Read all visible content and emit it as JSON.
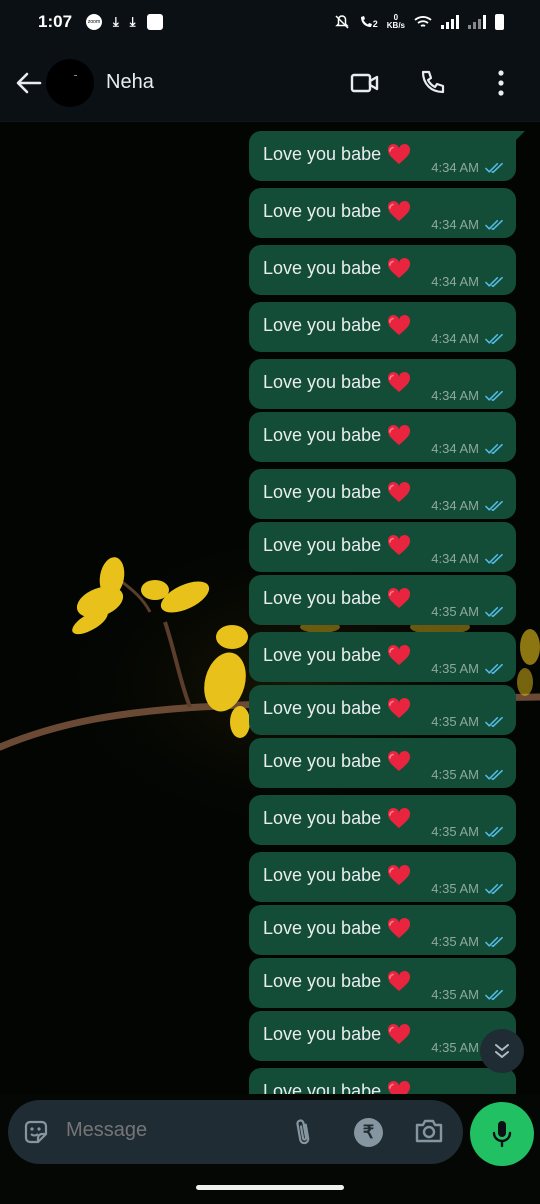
{
  "status_bar": {
    "time": "1:07",
    "data_speed_value": "0",
    "data_speed_unit": "KB/s",
    "sim_label": "2"
  },
  "header": {
    "contact_name": "Neha"
  },
  "messages": [
    {
      "text": "Love you babe",
      "time": "4:34 AM"
    },
    {
      "text": "Love you babe",
      "time": "4:34 AM"
    },
    {
      "text": "Love you babe",
      "time": "4:34 AM"
    },
    {
      "text": "Love you babe",
      "time": "4:34 AM"
    },
    {
      "text": "Love you babe",
      "time": "4:34 AM"
    },
    {
      "text": "Love you babe",
      "time": "4:34 AM"
    },
    {
      "text": "Love you babe",
      "time": "4:34 AM"
    },
    {
      "text": "Love you babe",
      "time": "4:34 AM"
    },
    {
      "text": "Love you babe",
      "time": "4:35 AM"
    },
    {
      "text": "Love you babe",
      "time": "4:35 AM"
    },
    {
      "text": "Love you babe",
      "time": "4:35 AM"
    },
    {
      "text": "Love you babe",
      "time": "4:35 AM"
    },
    {
      "text": "Love you babe",
      "time": "4:35 AM"
    },
    {
      "text": "Love you babe",
      "time": "4:35 AM"
    },
    {
      "text": "Love you babe",
      "time": "4:35 AM"
    },
    {
      "text": "Love you babe",
      "time": "4:35 AM"
    },
    {
      "text": "Love you babe",
      "time": "4:35 AM"
    },
    {
      "text": "Love you babe",
      "time": ""
    }
  ],
  "composer": {
    "placeholder": "Message"
  },
  "colors": {
    "bubble_outgoing": "#144d37",
    "read_ticks": "#53bdeb",
    "mic_button": "#21c063",
    "header_bg": "#0b1014"
  },
  "icons": [
    "back-arrow-icon",
    "video-call-icon",
    "voice-call-icon",
    "more-options-icon",
    "read-receipt-icon",
    "heart-emoji-icon",
    "scroll-down-icon",
    "sticker-icon",
    "attach-icon",
    "rupee-payment-icon",
    "camera-icon",
    "mic-icon"
  ]
}
